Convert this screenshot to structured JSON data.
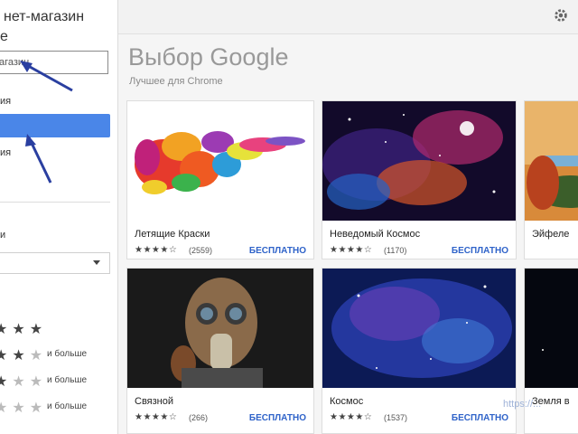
{
  "sidebar": {
    "title_line1": "нет-магазин",
    "title_line2": "е",
    "search_value": "агазин",
    "nav_item1": "ия",
    "nav_item2": "ия",
    "filter_label": "и",
    "ratings": [
      {
        "stars": 5,
        "more": ""
      },
      {
        "stars": 4,
        "more": "и больше"
      },
      {
        "stars": 3,
        "more": "и больше"
      },
      {
        "stars": 2,
        "more": "и больше"
      }
    ]
  },
  "main": {
    "section_title": "Выбор Google",
    "section_subtitle": "Лучшее для Chrome",
    "cards": [
      {
        "name": "Летящие Краски",
        "rating": "★★★★☆",
        "count": "(2559)",
        "price": "БЕСПЛАТНО"
      },
      {
        "name": "Неведомый Космос",
        "rating": "★★★★☆",
        "count": "(1170)",
        "price": "БЕСПЛАТНО"
      },
      {
        "name": "Эйфеле",
        "rating": "",
        "count": "",
        "price": ""
      },
      {
        "name": "Связной",
        "rating": "★★★★☆",
        "count": "(266)",
        "price": "БЕСПЛАТНО"
      },
      {
        "name": "Космос",
        "rating": "★★★★☆",
        "count": "(1537)",
        "price": "БЕСПЛАТНО"
      },
      {
        "name": "Земля в",
        "rating": "",
        "count": "",
        "price": ""
      }
    ]
  },
  "watermark_url": "https://...",
  "colors": {
    "accent": "#4a86e8",
    "price": "#2f63c9",
    "arrow": "#2a3fa0"
  }
}
